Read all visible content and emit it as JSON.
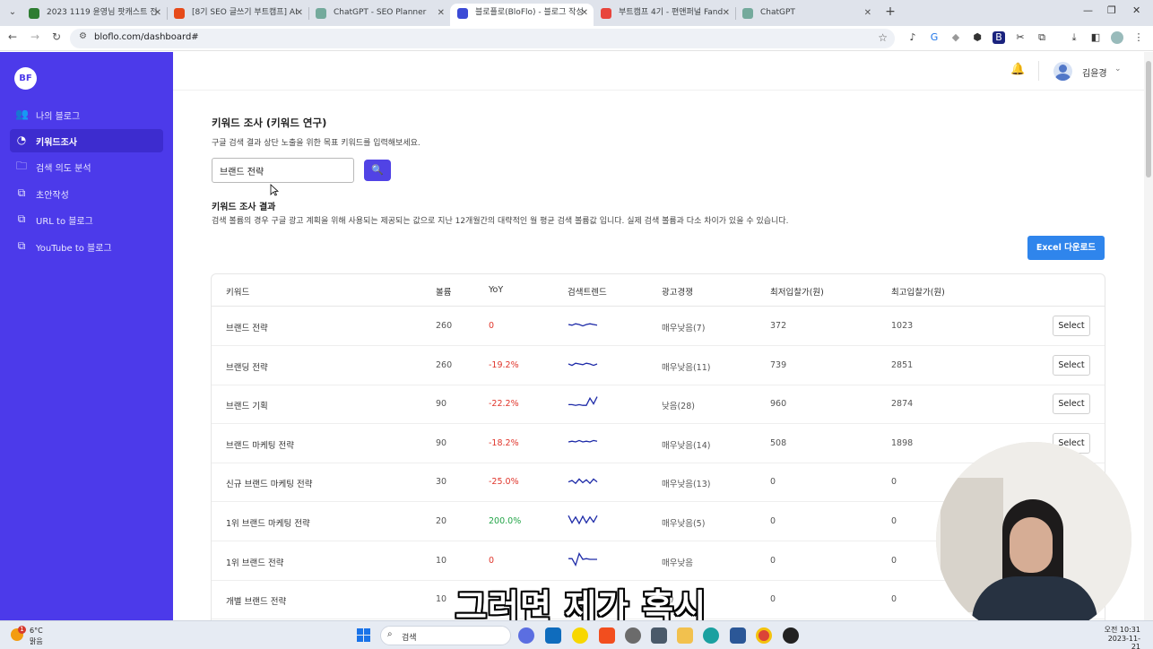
{
  "browser": {
    "tabs": [
      {
        "label": "2023 1119 윤영님 팟캐스트 전",
        "favicon_color": "#2e7d32"
      },
      {
        "label": "[8기 SEO 글쓰기 부트캠프] AI",
        "favicon_color": "#e64a19"
      },
      {
        "label": "ChatGPT - SEO Planner",
        "favicon_color": "#74aa9c"
      },
      {
        "label": "블로플로(BloFlo) - 블로그 작성",
        "favicon_color": "#3c4bd6"
      },
      {
        "label": "부트캠프 4기 - 편앤퍼널 Fand",
        "favicon_color": "#e8453c"
      },
      {
        "label": "ChatGPT",
        "favicon_color": "#74aa9c"
      }
    ],
    "url": "bloflo.com/dashboard#"
  },
  "sidebar": {
    "logo_text": "BF",
    "items": [
      {
        "label": "나의 블로그",
        "icon": "users-icon"
      },
      {
        "label": "키워드조사",
        "icon": "chart-icon"
      },
      {
        "label": "검색 의도 분석",
        "icon": "folder-icon"
      },
      {
        "label": "초안작성",
        "icon": "copy-icon"
      },
      {
        "label": "URL to 블로그",
        "icon": "copy-icon"
      },
      {
        "label": "YouTube to 블로그",
        "icon": "copy-icon"
      }
    ]
  },
  "header": {
    "user_name": "김윤경"
  },
  "keyword": {
    "title": "키워드 조사 (키워드 연구)",
    "description": "구글 검색 결과 상단 노출을 위한 목표 키워드를 입력해보세요.",
    "input_value": "브랜드 전략",
    "result_title": "키워드 조사 결과",
    "result_description": "검색 볼륨의 경우 구글 광고 계획을 위해 사용되는 제공되는 값으로 지난 12개월간의 대략적인 월 평균 검색 볼륨값 입니다. 실제 검색 볼륨과 다소 차이가 있을 수 있습니다.",
    "excel_label": "Excel 다운로드"
  },
  "table": {
    "headers": [
      "키워드",
      "볼륨",
      "YoY",
      "검색트렌드",
      "광고경쟁",
      "최저입찰가(원)",
      "최고입찰가(원)"
    ],
    "select_label": "Select",
    "rows": [
      {
        "keyword": "브랜드 전략",
        "volume": "260",
        "yoy": "0",
        "yoy_class": "neg",
        "trend": [
          0.5,
          0.45,
          0.55,
          0.5,
          0.4,
          0.5,
          0.55,
          0.5,
          0.45
        ],
        "competition": "매우낮음(7)",
        "min_bid": "372",
        "max_bid": "1023",
        "select": true
      },
      {
        "keyword": "브랜딩 전략",
        "volume": "260",
        "yoy": "-19.2%",
        "yoy_class": "neg",
        "trend": [
          0.5,
          0.4,
          0.55,
          0.5,
          0.45,
          0.55,
          0.5,
          0.4,
          0.5
        ],
        "competition": "매우낮음(11)",
        "min_bid": "739",
        "max_bid": "2851",
        "select": true
      },
      {
        "keyword": "브랜드 기획",
        "volume": "90",
        "yoy": "-22.2%",
        "yoy_class": "neg",
        "trend": [
          0.35,
          0.35,
          0.3,
          0.35,
          0.3,
          0.3,
          0.8,
          0.4,
          0.9
        ],
        "competition": "낮음(28)",
        "min_bid": "960",
        "max_bid": "2874",
        "select": true
      },
      {
        "keyword": "브랜드 마케팅 전략",
        "volume": "90",
        "yoy": "-18.2%",
        "yoy_class": "neg",
        "trend": [
          0.5,
          0.55,
          0.5,
          0.6,
          0.5,
          0.55,
          0.5,
          0.6,
          0.55
        ],
        "competition": "매우낮음(14)",
        "min_bid": "508",
        "max_bid": "1898",
        "select": true
      },
      {
        "keyword": "신규 브랜드 마케팅 전략",
        "volume": "30",
        "yoy": "-25.0%",
        "yoy_class": "neg",
        "trend": [
          0.4,
          0.5,
          0.3,
          0.6,
          0.35,
          0.55,
          0.3,
          0.6,
          0.4
        ],
        "competition": "매우낮음(13)",
        "min_bid": "0",
        "max_bid": "0",
        "select": false
      },
      {
        "keyword": "1위 브랜드 마케팅 전략",
        "volume": "20",
        "yoy": "200.0%",
        "yoy_class": "pos",
        "trend": [
          0.8,
          0.3,
          0.7,
          0.25,
          0.75,
          0.3,
          0.7,
          0.35,
          0.8
        ],
        "competition": "매우낮음(5)",
        "min_bid": "0",
        "max_bid": "0",
        "select": false
      },
      {
        "keyword": "1위 브랜드 전략",
        "volume": "10",
        "yoy": "0",
        "yoy_class": "neg",
        "trend": [
          0.55,
          0.55,
          0.1,
          0.9,
          0.5,
          0.55,
          0.5,
          0.5,
          0.5
        ],
        "competition": "매우낮음",
        "min_bid": "0",
        "max_bid": "0",
        "select": false
      },
      {
        "keyword": "개별 브랜드 전략",
        "volume": "10",
        "yoy": "",
        "yoy_class": "neg",
        "trend": [],
        "competition": "(7)",
        "min_bid": "0",
        "max_bid": "0",
        "select": false
      }
    ]
  },
  "subtitle": "그러면 제가 혹시",
  "taskbar": {
    "temperature": "6°C",
    "weather": "맑음",
    "weather_badge": "1",
    "search_label": "검색",
    "time": "오전 10:31",
    "date": "2023-11-21"
  },
  "colors": {
    "sidebar": "#4c3aea",
    "accent": "#5143e5",
    "excel": "#2f85ec",
    "trend_line": "#1d2aa8",
    "negative": "#e0352b",
    "positive": "#22a447"
  }
}
